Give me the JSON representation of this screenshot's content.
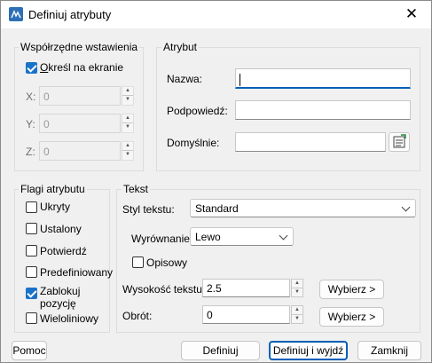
{
  "window": {
    "title": "Definiuj atrybuty",
    "close_glyph": "✕",
    "app_icon": "edit-attribute-icon"
  },
  "insertion": {
    "group_label": "Współrzędne wstawienia",
    "specify_on_screen": {
      "label": "Określ na ekranie",
      "checked": true
    },
    "x": {
      "label": "X:",
      "value": "0"
    },
    "y": {
      "label": "Y:",
      "value": "0"
    },
    "z": {
      "label": "Z:",
      "value": "0"
    }
  },
  "attribute": {
    "group_label": "Atrybut",
    "name": {
      "label": "Nazwa:",
      "value": ""
    },
    "prompt": {
      "label": "Podpowiedź:",
      "value": ""
    },
    "default": {
      "label": "Domyślnie:",
      "value": "",
      "field_button_icon": "insert-field-icon"
    }
  },
  "flags": {
    "group_label": "Flagi atrybutu",
    "items": [
      {
        "label": "Ukryty",
        "checked": false
      },
      {
        "label": "Ustalony",
        "checked": false
      },
      {
        "label": "Potwierdź",
        "checked": false
      },
      {
        "label": "Predefiniowany",
        "checked": false
      },
      {
        "label_line1": "Zablokuj",
        "label_line2": "pozycję",
        "checked": true
      },
      {
        "label": "Wieloliniowy",
        "checked": false
      }
    ]
  },
  "text": {
    "group_label": "Tekst",
    "style": {
      "label": "Styl tekstu:",
      "value": "Standard"
    },
    "justification": {
      "label": "Wyrównanie:",
      "value": "Lewo"
    },
    "annotative": {
      "label": "Opisowy",
      "checked": false
    },
    "height": {
      "label": "Wysokość tekstu:",
      "value": "2.5",
      "pick_label": "Wybierz >"
    },
    "rotation": {
      "label": "Obrót:",
      "value": "0",
      "pick_label": "Wybierz >"
    }
  },
  "buttons": {
    "help": "Pomoc",
    "define": "Definiuj",
    "define_exit": "Definiuj i wyjdź",
    "close": "Zamknij"
  }
}
